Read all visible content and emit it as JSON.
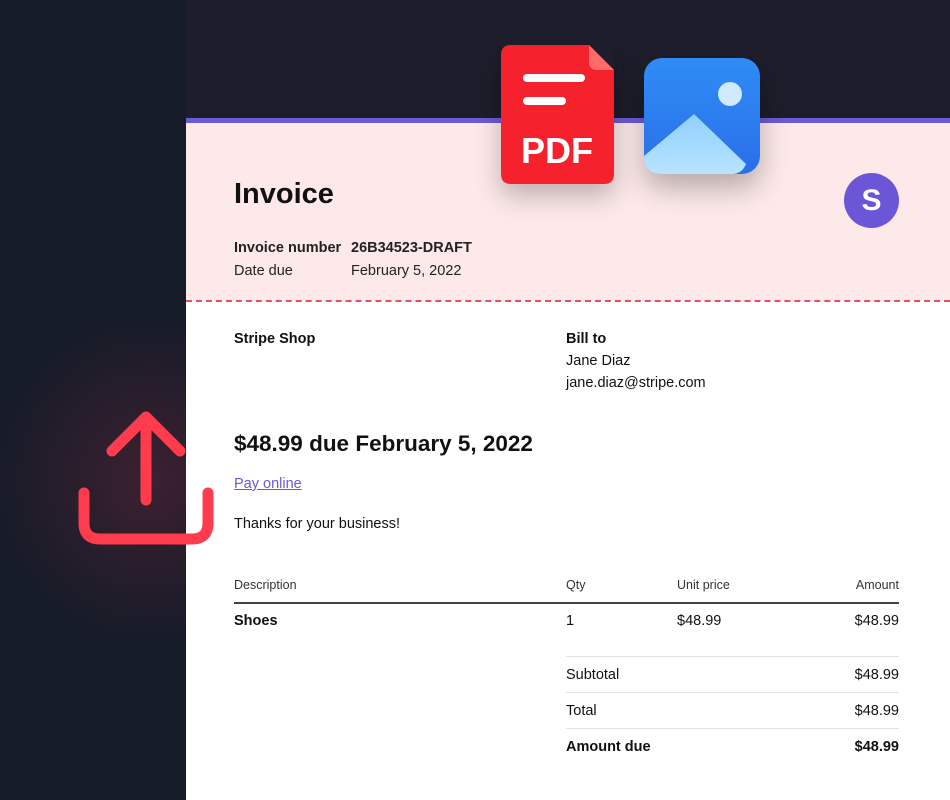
{
  "invoice": {
    "title": "Invoice",
    "logo_letter": "S",
    "invoice_number_label": "Invoice number",
    "invoice_number": "26B34523-DRAFT",
    "date_due_label": "Date due",
    "date_due": "February 5, 2022",
    "seller": "Stripe Shop",
    "bill_to_label": "Bill to",
    "customer_name": "Jane Diaz",
    "customer_email": "jane.diaz@stripe.com",
    "due_summary": "$48.99 due February 5, 2022",
    "pay_online": "Pay online",
    "thanks": "Thanks for your business!",
    "table": {
      "headers": {
        "description": "Description",
        "qty": "Qty",
        "unit_price": "Unit price",
        "amount": "Amount"
      },
      "items": [
        {
          "description": "Shoes",
          "qty": "1",
          "unit_price": "$48.99",
          "amount": "$48.99"
        }
      ]
    },
    "totals": {
      "subtotal_label": "Subtotal",
      "subtotal": "$48.99",
      "total_label": "Total",
      "total": "$48.99",
      "amount_due_label": "Amount due",
      "amount_due": "$48.99"
    }
  },
  "icons": {
    "pdf": {
      "name": "pdf-file-icon",
      "text": "PDF",
      "color": "#f5222d"
    },
    "image": {
      "name": "image-file-icon",
      "color": "#2f7ef0"
    },
    "upload": {
      "name": "upload-icon",
      "color": "#ff3b4e"
    }
  },
  "colors": {
    "accent": "#6b56d8",
    "header_bg": "#fde9ea",
    "dashed_line": "#e8505b"
  }
}
